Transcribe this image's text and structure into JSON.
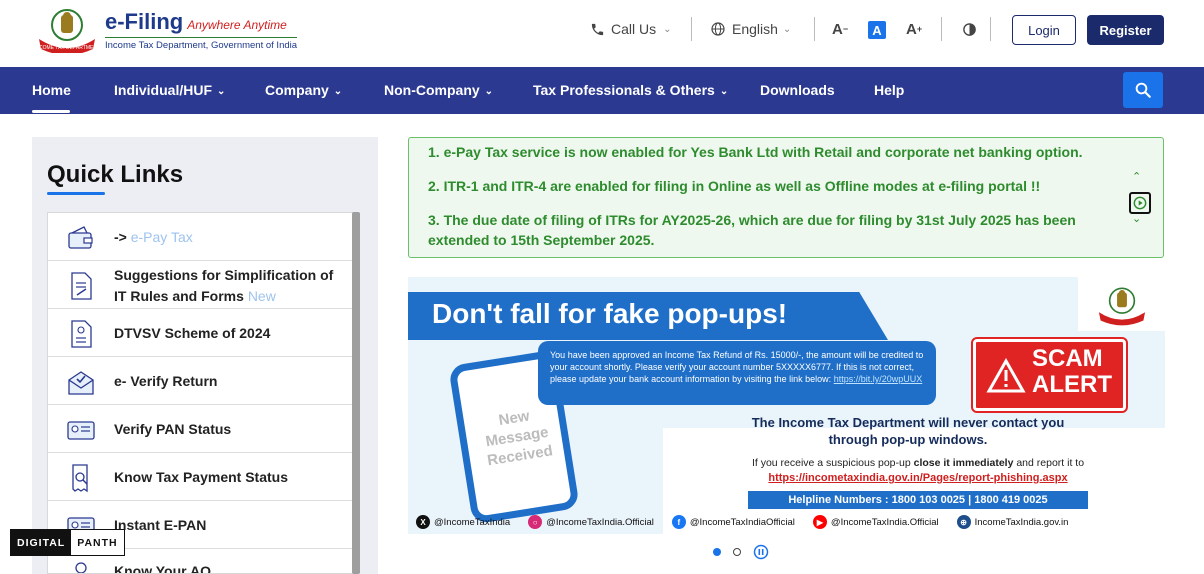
{
  "header": {
    "logo_title": "e-Filing",
    "logo_tagline": "Anywhere Anytime",
    "logo_subtitle": "Income Tax Department, Government of India",
    "emblem_text": "INCOME TAX DEPARTMENT",
    "call_us": "Call Us",
    "language": "English",
    "font_decrease": "A",
    "font_normal": "A",
    "font_increase": "A",
    "login": "Login",
    "register": "Register"
  },
  "nav": {
    "items": [
      {
        "label": "Home",
        "dropdown": false
      },
      {
        "label": "Individual/HUF",
        "dropdown": true
      },
      {
        "label": "Company",
        "dropdown": true
      },
      {
        "label": "Non-Company",
        "dropdown": true
      },
      {
        "label": "Tax Professionals & Others",
        "dropdown": true
      },
      {
        "label": "Downloads",
        "dropdown": false
      },
      {
        "label": "Help",
        "dropdown": false
      }
    ],
    "chevron": "⌄",
    "search_icon": "search-icon"
  },
  "quick_links": {
    "title": "Quick Links",
    "items": [
      {
        "prefix": "->",
        "label": "e-Pay Tax",
        "icon": "wallet-icon"
      },
      {
        "label": "Suggestions for Simplification of IT Rules and Forms",
        "tag": "New",
        "icon": "document-edit-icon"
      },
      {
        "label": "DTVSV Scheme of 2024",
        "icon": "document-icon"
      },
      {
        "label": "e- Verify Return",
        "icon": "email-verify-icon"
      },
      {
        "label": "Verify PAN Status",
        "icon": "id-card-icon"
      },
      {
        "label": "Know Tax Payment Status",
        "icon": "receipt-search-icon"
      },
      {
        "label": "Instant E-PAN",
        "icon": "id-card-icon"
      },
      {
        "label": "Know Your AO",
        "icon": "person-icon"
      }
    ]
  },
  "notices": [
    "1. e-Pay Tax service is now enabled for Yes Bank Ltd with Retail and corporate net banking option.",
    "2. ITR-1 and ITR-4 are enabled for filing in Online as well as Offline modes at e-filing portal !!",
    "3. The due date of filing of ITRs for AY2025-26, which are due for filing by 31st July 2025 has been extended to 15th September 2025."
  ],
  "banner": {
    "headline": "Don't fall for fake pop-ups!",
    "phone_text": "New Message Received",
    "bubble_text": "You have been approved an Income Tax Refund of Rs. 15000/-, the amount will be credited to your account shortly. Please verify your account number 5XXXXX6777. If this is not correct, please update your bank account information by visiting the link below:",
    "bubble_link": "https://bit.ly/20wpUUX",
    "scam_line1": "SCAM",
    "scam_line2": "ALERT",
    "never_contact": "The Income Tax Department will never contact you through pop-up windows.",
    "if_receive_1": "If you receive a suspicious pop-up",
    "if_receive_bold": "close it immediately",
    "if_receive_2": "and report it to",
    "report_url": "https://incometaxindia.gov.in/Pages/report-phishing.aspx",
    "helpline": "Helpline Numbers : 1800 103 0025 | 1800 419 0025",
    "social": [
      {
        "handle": "@IncomeTaxIndia",
        "icon": "x-icon",
        "color": "#111111"
      },
      {
        "handle": "@IncomeTaxIndia.Official",
        "icon": "instagram-icon",
        "color": "#d62976"
      },
      {
        "handle": "@IncomeTaxIndiaOfficial",
        "icon": "facebook-icon",
        "color": "#1877f2"
      },
      {
        "handle": "@IncomeTaxIndia.Official",
        "icon": "youtube-icon",
        "color": "#ff0000"
      },
      {
        "handle": "IncomeTaxIndia.gov.in",
        "icon": "globe-icon",
        "color": "#1f4f8a"
      }
    ]
  },
  "carousel": {
    "slide_count": 2,
    "active_index": 0
  },
  "watermark": {
    "part1": "DIGITAL",
    "part2": "PANTH"
  },
  "colors": {
    "nav_bg": "#2b3990",
    "primary": "#1b2a6b",
    "notice_green": "#2e8b2e",
    "accent_blue": "#1a73e8"
  }
}
